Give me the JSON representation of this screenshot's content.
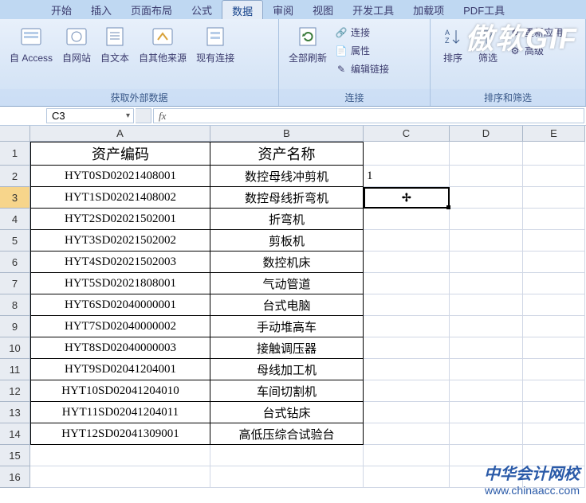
{
  "tabs": {
    "start": "开始",
    "insert": "插入",
    "layout": "页面布局",
    "formula": "公式",
    "data": "数据",
    "review": "审阅",
    "view": "视图",
    "dev": "开发工具",
    "addin": "加载项",
    "pdf": "PDF工具"
  },
  "ribbon": {
    "group_external": {
      "label": "获取外部数据",
      "access": "自 Access",
      "web": "自网站",
      "text": "自文本",
      "other": "自其他来源",
      "existing": "现有连接"
    },
    "group_conn": {
      "label": "连接",
      "refresh": "全部刷新",
      "connections": "连接",
      "properties": "属性",
      "editlinks": "编辑链接"
    },
    "group_sort": {
      "label": "排序和筛选",
      "sort": "排序",
      "filter": "筛选",
      "reapply": "重新应用",
      "advanced": "高级"
    }
  },
  "namebox": "C3",
  "formula": "",
  "columns": {
    "A": "A",
    "B": "B",
    "C": "C",
    "D": "D",
    "E": "E"
  },
  "sheet": {
    "header": {
      "A": "资产编码",
      "B": "资产名称"
    },
    "rows": [
      {
        "n": 2,
        "A": "HYT0SD02021408001",
        "B": "数控母线冲剪机",
        "C": "1"
      },
      {
        "n": 3,
        "A": "HYT1SD02021408002",
        "B": "数控母线折弯机",
        "C": ""
      },
      {
        "n": 4,
        "A": "HYT2SD02021502001",
        "B": "折弯机",
        "C": ""
      },
      {
        "n": 5,
        "A": "HYT3SD02021502002",
        "B": "剪板机",
        "C": ""
      },
      {
        "n": 6,
        "A": "HYT4SD02021502003",
        "B": "数控机床",
        "C": ""
      },
      {
        "n": 7,
        "A": "HYT5SD02021808001",
        "B": "气动管道",
        "C": ""
      },
      {
        "n": 8,
        "A": "HYT6SD02040000001",
        "B": "台式电脑",
        "C": ""
      },
      {
        "n": 9,
        "A": "HYT7SD02040000002",
        "B": "手动堆高车",
        "C": ""
      },
      {
        "n": 10,
        "A": "HYT8SD02040000003",
        "B": "接触调压器",
        "C": ""
      },
      {
        "n": 11,
        "A": "HYT9SD02041204001",
        "B": "母线加工机",
        "C": ""
      },
      {
        "n": 12,
        "A": "HYT10SD02041204010",
        "B": "车间切割机",
        "C": ""
      },
      {
        "n": 13,
        "A": "HYT11SD02041204011",
        "B": "台式钻床",
        "C": ""
      },
      {
        "n": 14,
        "A": "HYT12SD02041309001",
        "B": "高低压综合试验台",
        "C": ""
      }
    ],
    "empty_rows": [
      15,
      16
    ]
  },
  "watermark": {
    "gif": "傲软GIF",
    "brand": "中华会计网校",
    "url": "www.chinaacc.com"
  }
}
